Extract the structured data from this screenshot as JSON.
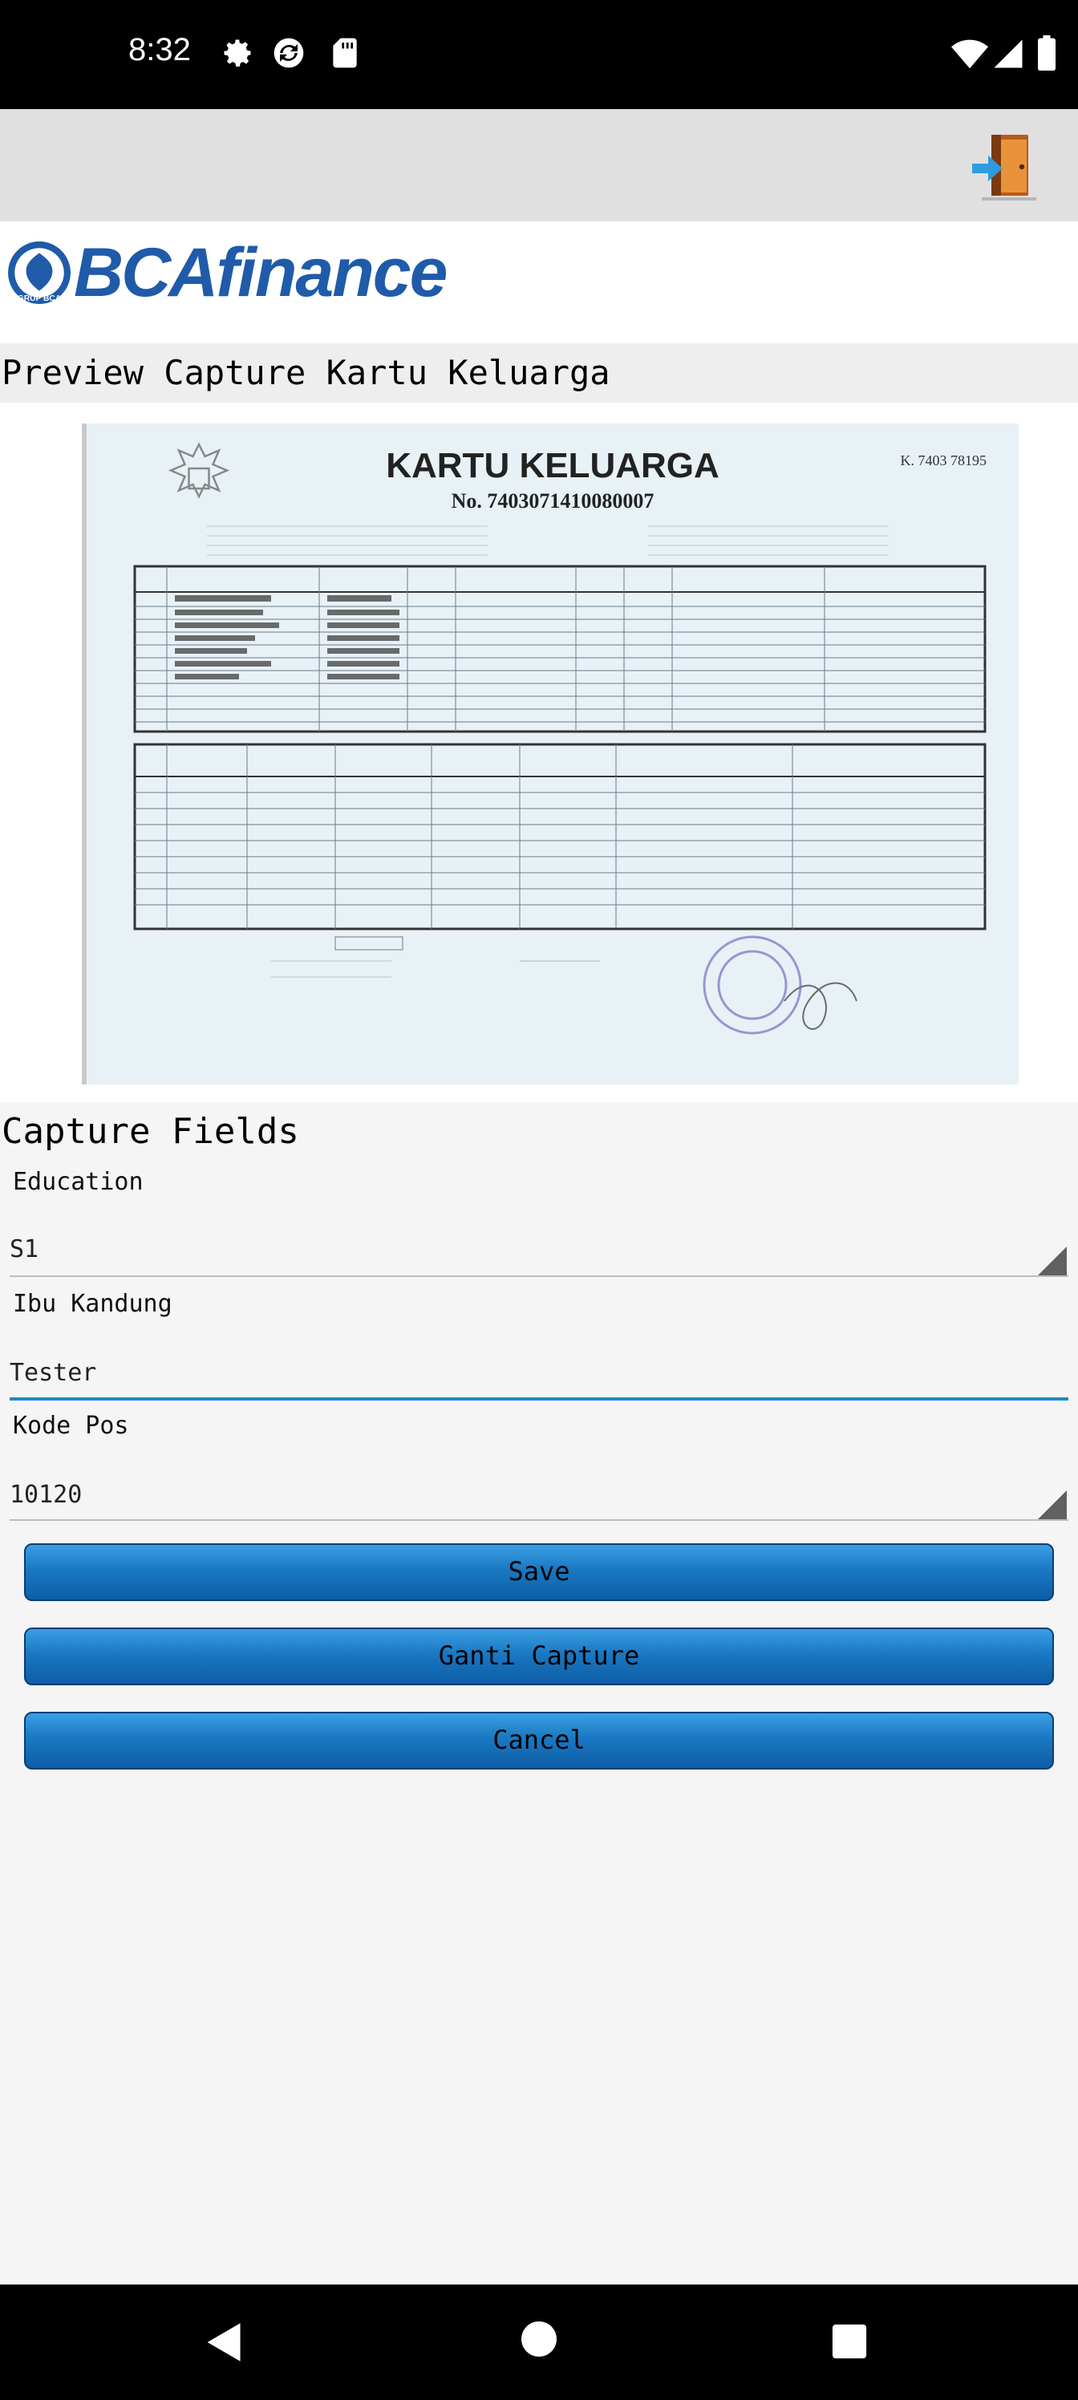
{
  "status_bar": {
    "time": "8:32",
    "left_icons": [
      "gear-icon",
      "sync-icon",
      "sd-card-icon"
    ],
    "right_icons": [
      "wifi-icon",
      "signal-icon",
      "battery-icon"
    ]
  },
  "app_bar": {
    "exit_icon": "exit-door-icon"
  },
  "logo": {
    "brand_bca": "BCA",
    "brand_finance": "finance",
    "emblem_text": "GRUP BCA"
  },
  "preview": {
    "header": "Preview Capture Kartu Keluarga",
    "document": {
      "title": "KARTU KELUARGA",
      "number": "No. 7403071410080007",
      "ref": "K. 7403 78195"
    }
  },
  "capture": {
    "header": "Capture Fields",
    "fields": [
      {
        "label": "Education",
        "value": "S1",
        "type": "dropdown"
      },
      {
        "label": "Ibu Kandung",
        "value": "Tester",
        "type": "text"
      },
      {
        "label": "Kode Pos",
        "value": "10120",
        "type": "dropdown"
      }
    ]
  },
  "buttons": {
    "save": "Save",
    "change_capture": "Ganti Capture",
    "cancel": "Cancel"
  },
  "nav_bar": {
    "icons": [
      "back-icon",
      "home-icon",
      "recents-icon"
    ]
  },
  "colors": {
    "button_blue": "#1a78c2",
    "brand_blue": "#1f5ba9",
    "active_underline": "#1e88c8"
  }
}
